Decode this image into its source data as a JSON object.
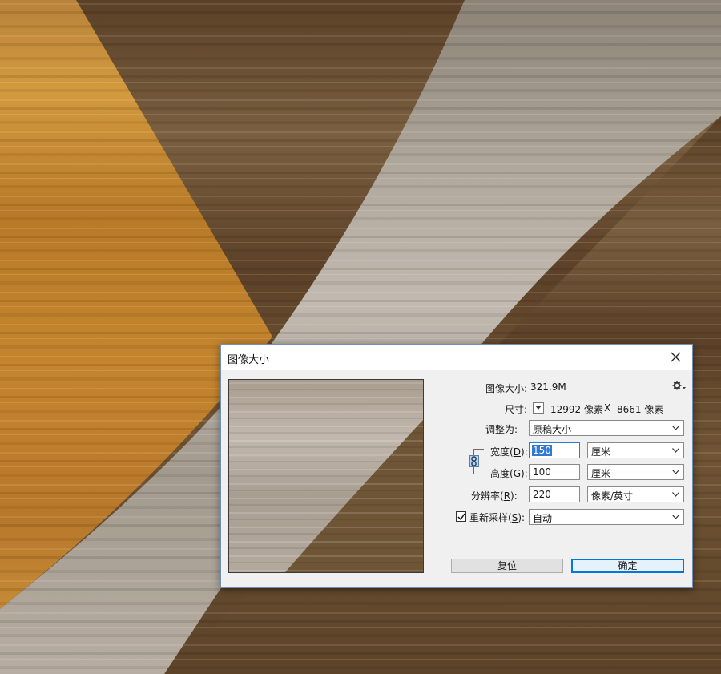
{
  "dialog": {
    "title": "图像大小",
    "image_size_label": "图像大小:",
    "image_size_value": "321.9M",
    "dimensions_label": "尺寸:",
    "dimensions_width": "12992 像素",
    "dimensions_x": "X",
    "dimensions_height": "8661 像素",
    "fit_to_label": "调整为:",
    "fit_to_value": "原稿大小",
    "width_label_pre": "宽度(",
    "width_label_key": "D",
    "width_label_post": "):",
    "width_value": "150",
    "width_unit": "厘米",
    "height_label_pre": "高度(",
    "height_label_key": "G",
    "height_label_post": "):",
    "height_value": "100",
    "height_unit": "厘米",
    "resolution_label_pre": "分辨率(",
    "resolution_label_key": "R",
    "resolution_label_post": "):",
    "resolution_value": "220",
    "resolution_unit": "像素/英寸",
    "resample_label_pre": "重新采样(",
    "resample_label_key": "S",
    "resample_label_post": "):",
    "resample_checked": true,
    "resample_value": "自动",
    "reset_label": "复位",
    "ok_label": "确定"
  },
  "icons": {
    "close": "close-icon",
    "gear": "gear-icon",
    "chain": "link-icon",
    "dropdown": "chevron-down-icon",
    "check": "checkmark-icon"
  },
  "colors": {
    "canvas_orange": "#c98a2e",
    "canvas_brown": "#6b5030",
    "canvas_grey": "#a89c8c",
    "accent": "#0078d7"
  }
}
